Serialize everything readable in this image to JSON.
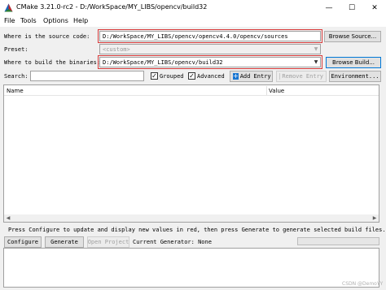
{
  "window": {
    "title": "CMake 3.21.0-rc2 - D:/WorkSpace/MY_LIBS/opencv/build32",
    "minimize": "—",
    "maximize": "☐",
    "close": "✕"
  },
  "menu": {
    "file": "File",
    "tools": "Tools",
    "options": "Options",
    "help": "Help"
  },
  "source": {
    "label": "Where is the source code:",
    "value": "D:/WorkSpace/MY_LIBS/opencv/opencv4.4.0/opencv/sources",
    "browse": "Browse Source..."
  },
  "preset": {
    "label": "Preset:",
    "value": "<custom>"
  },
  "binaries": {
    "label": "Where to build the binaries:",
    "value": "D:/WorkSpace/MY_LIBS/opencv/build32",
    "browse": "Browse Build..."
  },
  "toolbar": {
    "search_label": "Search:",
    "search_value": "",
    "grouped_label": "Grouped",
    "grouped_checked": true,
    "advanced_label": "Advanced",
    "advanced_checked": true,
    "add_entry": "Add Entry",
    "remove_entry": "Remove Entry",
    "environment": "Environment..."
  },
  "table": {
    "columns": [
      "Name",
      "Value"
    ]
  },
  "status": {
    "hint": "Press Configure to update and display new values in red, then press Generate to generate selected build files.",
    "configure": "Configure",
    "generate": "Generate",
    "open_project": "Open Project",
    "current_generator": "Current Generator: None"
  },
  "watermark": "CSDN @DemoYY",
  "colors": {
    "highlight": "#d73a3a",
    "focus": "#0078d7"
  }
}
